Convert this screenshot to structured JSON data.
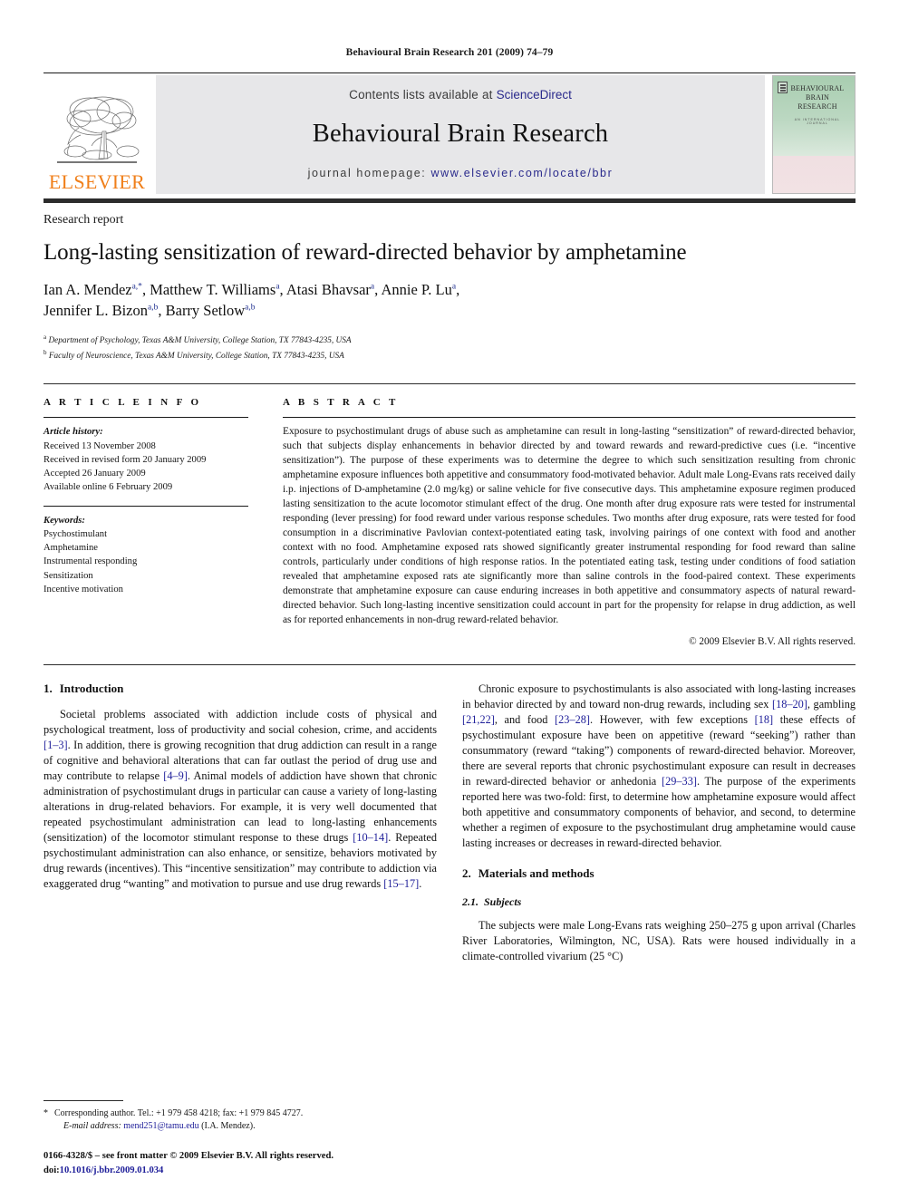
{
  "running_head": "Behavioural Brain Research 201 (2009) 74–79",
  "masthead": {
    "publisher_name": "ELSEVIER",
    "contents_prefix": "Contents lists available at ",
    "contents_link": "ScienceDirect",
    "journal_title": "Behavioural Brain Research",
    "homepage_prefix": "journal homepage: ",
    "homepage_url": "www.elsevier.com/locate/bbr",
    "cover": {
      "title_line1": "BEHAVIOURAL",
      "title_line2": "BRAIN",
      "title_line3": "RESEARCH",
      "subtitle": "AN INTERNATIONAL JOURNAL"
    },
    "colors": {
      "band_background": "#e7e7e9",
      "link": "#2a2a8c",
      "elsevier_orange": "#F07F1A",
      "cover_green": "#a8cdb0",
      "cover_pink": "#f0dfe2"
    }
  },
  "article": {
    "doctype": "Research report",
    "title": "Long-lasting sensitization of reward-directed behavior by amphetamine",
    "authors_line1_pre": "Ian A. Mendez",
    "authors_line1_sup1": "a,*",
    "authors_line1_mid1": ", Matthew T. Williams",
    "authors_line1_sup2": "a",
    "authors_line1_mid2": ", Atasi Bhavsar",
    "authors_line1_sup3": "a",
    "authors_line1_mid3": ", Annie P. Lu",
    "authors_line1_sup4": "a",
    "authors_line1_end": ",",
    "authors_line2_pre": "Jennifer L. Bizon",
    "authors_line2_sup1": "a,b",
    "authors_line2_mid": ", Barry Setlow",
    "authors_line2_sup2": "a,b",
    "affiliations": [
      {
        "marker": "a",
        "text": "Department of Psychology, Texas A&M University, College Station, TX 77843-4235, USA"
      },
      {
        "marker": "b",
        "text": "Faculty of Neuroscience, Texas A&M University, College Station, TX 77843-4235, USA"
      }
    ]
  },
  "article_info": {
    "heading": "A R T I C L E   I N F O",
    "history_label": "Article history:",
    "history": [
      "Received 13 November 2008",
      "Received in revised form 20 January 2009",
      "Accepted 26 January 2009",
      "Available online 6 February 2009"
    ],
    "keywords_label": "Keywords:",
    "keywords": [
      "Psychostimulant",
      "Amphetamine",
      "Instrumental responding",
      "Sensitization",
      "Incentive motivation"
    ]
  },
  "abstract": {
    "heading": "A B S T R A C T",
    "text": "Exposure to psychostimulant drugs of abuse such as amphetamine can result in long-lasting “sensitization” of reward-directed behavior, such that subjects display enhancements in behavior directed by and toward rewards and reward-predictive cues (i.e. “incentive sensitization”). The purpose of these experiments was to determine the degree to which such sensitization resulting from chronic amphetamine exposure influences both appetitive and consummatory food-motivated behavior. Adult male Long-Evans rats received daily i.p. injections of D-amphetamine (2.0 mg/kg) or saline vehicle for five consecutive days. This amphetamine exposure regimen produced lasting sensitization to the acute locomotor stimulant effect of the drug. One month after drug exposure rats were tested for instrumental responding (lever pressing) for food reward under various response schedules. Two months after drug exposure, rats were tested for food consumption in a discriminative Pavlovian context-potentiated eating task, involving pairings of one context with food and another context with no food. Amphetamine exposed rats showed significantly greater instrumental responding for food reward than saline controls, particularly under conditions of high response ratios. In the potentiated eating task, testing under conditions of food satiation revealed that amphetamine exposed rats ate significantly more than saline controls in the food-paired context. These experiments demonstrate that amphetamine exposure can cause enduring increases in both appetitive and consummatory aspects of natural reward-directed behavior. Such long-lasting incentive sensitization could account in part for the propensity for relapse in drug addiction, as well as for reported enhancements in non-drug reward-related behavior.",
    "copyright": "© 2009 Elsevier B.V. All rights reserved."
  },
  "body": {
    "section1_num": "1.",
    "section1_title": "Introduction",
    "intro_p1_a": "Societal problems associated with addiction include costs of physical and psychological treatment, loss of productivity and social cohesion, crime, and accidents ",
    "intro_p1_ref1": "[1–3]",
    "intro_p1_b": ". In addition, there is growing recognition that drug addiction can result in a range of cognitive and behavioral alterations that can far outlast the period of drug use and may contribute to relapse ",
    "intro_p1_ref2": "[4–9]",
    "intro_p1_c": ". Animal models of addiction have shown that chronic administration of psychostimulant drugs in particular can cause a variety of long-lasting alterations in drug-related behaviors. For example, it is very well documented that repeated psychostimulant administration can lead to long-lasting enhancements (sensitization) of the locomotor stimulant response to these drugs ",
    "intro_p1_ref3": "[10–14]",
    "intro_p1_d": ". Repeated psychostimulant administration can also enhance, or sensitize, behaviors motivated by drug rewards (incentives). This “incentive sensitization” may contribute to addiction via exaggerated drug “wanting” and motivation to pursue and use drug rewards ",
    "intro_p1_ref4": "[15–17]",
    "intro_p1_e": ".",
    "intro_p2_a": "Chronic exposure to psychostimulants is also associated with long-lasting increases in behavior directed by and toward non-drug rewards, including sex ",
    "intro_p2_ref1": "[18–20]",
    "intro_p2_b": ", gambling ",
    "intro_p2_ref2": "[21,22]",
    "intro_p2_c": ", and food ",
    "intro_p2_ref3": "[23–28]",
    "intro_p2_d": ". However, with few exceptions ",
    "intro_p2_ref4": "[18]",
    "intro_p2_e": " these effects of psychostimulant exposure have been on appetitive (reward “seeking”) rather than consummatory (reward “taking”) components of reward-directed behavior. Moreover, there are several reports that chronic psychostimulant exposure can result in decreases in reward-directed behavior or anhedonia ",
    "intro_p2_ref5": "[29–33]",
    "intro_p2_f": ". The purpose of the experiments reported here was two-fold: first, to determine how amphetamine exposure would affect both appetitive and consummatory components of behavior, and second, to determine whether a regimen of exposure to the psychostimulant drug amphetamine would cause lasting increases or decreases in reward-directed behavior.",
    "section2_num": "2.",
    "section2_title": "Materials and methods",
    "section21_num": "2.1.",
    "section21_title": "Subjects",
    "subjects_p1": "The subjects were male Long-Evans rats weighing 250–275 g upon arrival (Charles River Laboratories, Wilmington, NC, USA). Rats were housed individually in a climate-controlled vivarium (25 °C)"
  },
  "footnote": {
    "star": "*",
    "corresponding_text": "Corresponding author. Tel.: +1 979 458 4218; fax: +1 979 845 4727.",
    "email_label": "E-mail address:",
    "email": "mend251@tamu.edu",
    "email_suffix": "(I.A. Mendez).",
    "issn_line": "0166-4328/$ – see front matter © 2009 Elsevier B.V. All rights reserved.",
    "doi_label": "doi:",
    "doi_value": "10.1016/j.bbr.2009.01.034"
  }
}
